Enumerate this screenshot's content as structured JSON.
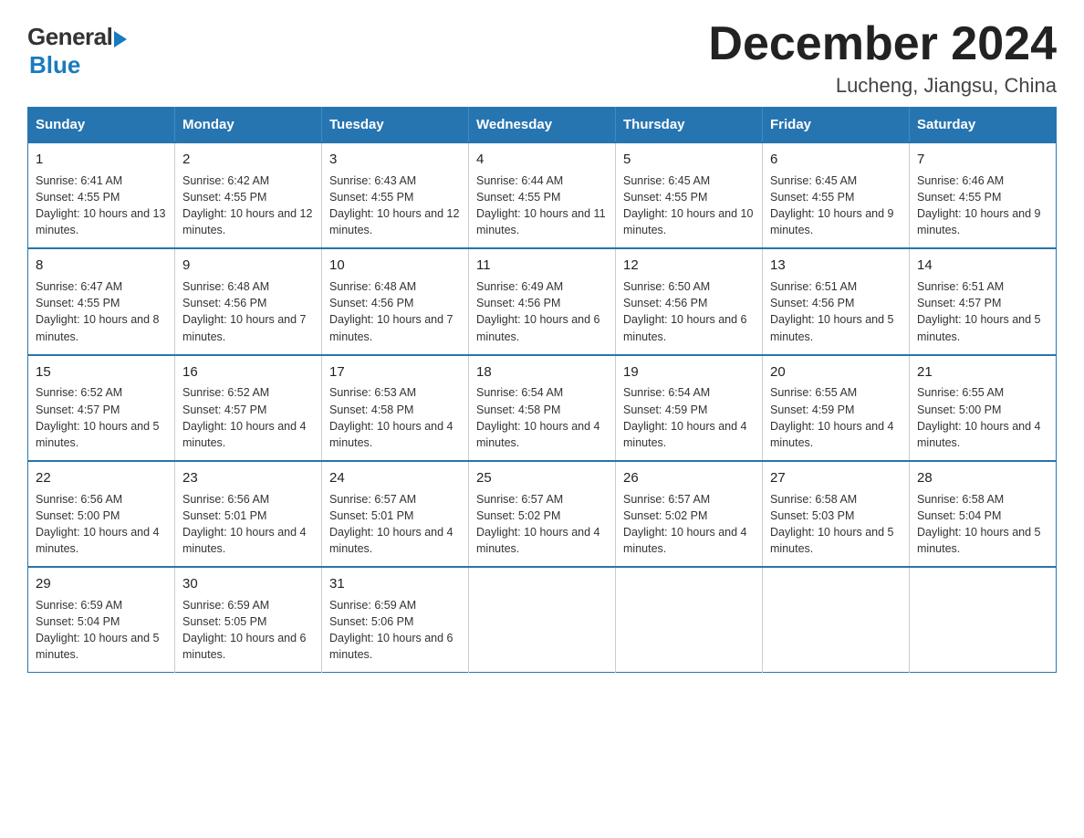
{
  "logo": {
    "general": "General",
    "blue": "Blue"
  },
  "title": "December 2024",
  "location": "Lucheng, Jiangsu, China",
  "days_of_week": [
    "Sunday",
    "Monday",
    "Tuesday",
    "Wednesday",
    "Thursday",
    "Friday",
    "Saturday"
  ],
  "weeks": [
    [
      {
        "num": "1",
        "sunrise": "6:41 AM",
        "sunset": "4:55 PM",
        "daylight": "10 hours and 13 minutes."
      },
      {
        "num": "2",
        "sunrise": "6:42 AM",
        "sunset": "4:55 PM",
        "daylight": "10 hours and 12 minutes."
      },
      {
        "num": "3",
        "sunrise": "6:43 AM",
        "sunset": "4:55 PM",
        "daylight": "10 hours and 12 minutes."
      },
      {
        "num": "4",
        "sunrise": "6:44 AM",
        "sunset": "4:55 PM",
        "daylight": "10 hours and 11 minutes."
      },
      {
        "num": "5",
        "sunrise": "6:45 AM",
        "sunset": "4:55 PM",
        "daylight": "10 hours and 10 minutes."
      },
      {
        "num": "6",
        "sunrise": "6:45 AM",
        "sunset": "4:55 PM",
        "daylight": "10 hours and 9 minutes."
      },
      {
        "num": "7",
        "sunrise": "6:46 AM",
        "sunset": "4:55 PM",
        "daylight": "10 hours and 9 minutes."
      }
    ],
    [
      {
        "num": "8",
        "sunrise": "6:47 AM",
        "sunset": "4:55 PM",
        "daylight": "10 hours and 8 minutes."
      },
      {
        "num": "9",
        "sunrise": "6:48 AM",
        "sunset": "4:56 PM",
        "daylight": "10 hours and 7 minutes."
      },
      {
        "num": "10",
        "sunrise": "6:48 AM",
        "sunset": "4:56 PM",
        "daylight": "10 hours and 7 minutes."
      },
      {
        "num": "11",
        "sunrise": "6:49 AM",
        "sunset": "4:56 PM",
        "daylight": "10 hours and 6 minutes."
      },
      {
        "num": "12",
        "sunrise": "6:50 AM",
        "sunset": "4:56 PM",
        "daylight": "10 hours and 6 minutes."
      },
      {
        "num": "13",
        "sunrise": "6:51 AM",
        "sunset": "4:56 PM",
        "daylight": "10 hours and 5 minutes."
      },
      {
        "num": "14",
        "sunrise": "6:51 AM",
        "sunset": "4:57 PM",
        "daylight": "10 hours and 5 minutes."
      }
    ],
    [
      {
        "num": "15",
        "sunrise": "6:52 AM",
        "sunset": "4:57 PM",
        "daylight": "10 hours and 5 minutes."
      },
      {
        "num": "16",
        "sunrise": "6:52 AM",
        "sunset": "4:57 PM",
        "daylight": "10 hours and 4 minutes."
      },
      {
        "num": "17",
        "sunrise": "6:53 AM",
        "sunset": "4:58 PM",
        "daylight": "10 hours and 4 minutes."
      },
      {
        "num": "18",
        "sunrise": "6:54 AM",
        "sunset": "4:58 PM",
        "daylight": "10 hours and 4 minutes."
      },
      {
        "num": "19",
        "sunrise": "6:54 AM",
        "sunset": "4:59 PM",
        "daylight": "10 hours and 4 minutes."
      },
      {
        "num": "20",
        "sunrise": "6:55 AM",
        "sunset": "4:59 PM",
        "daylight": "10 hours and 4 minutes."
      },
      {
        "num": "21",
        "sunrise": "6:55 AM",
        "sunset": "5:00 PM",
        "daylight": "10 hours and 4 minutes."
      }
    ],
    [
      {
        "num": "22",
        "sunrise": "6:56 AM",
        "sunset": "5:00 PM",
        "daylight": "10 hours and 4 minutes."
      },
      {
        "num": "23",
        "sunrise": "6:56 AM",
        "sunset": "5:01 PM",
        "daylight": "10 hours and 4 minutes."
      },
      {
        "num": "24",
        "sunrise": "6:57 AM",
        "sunset": "5:01 PM",
        "daylight": "10 hours and 4 minutes."
      },
      {
        "num": "25",
        "sunrise": "6:57 AM",
        "sunset": "5:02 PM",
        "daylight": "10 hours and 4 minutes."
      },
      {
        "num": "26",
        "sunrise": "6:57 AM",
        "sunset": "5:02 PM",
        "daylight": "10 hours and 4 minutes."
      },
      {
        "num": "27",
        "sunrise": "6:58 AM",
        "sunset": "5:03 PM",
        "daylight": "10 hours and 5 minutes."
      },
      {
        "num": "28",
        "sunrise": "6:58 AM",
        "sunset": "5:04 PM",
        "daylight": "10 hours and 5 minutes."
      }
    ],
    [
      {
        "num": "29",
        "sunrise": "6:59 AM",
        "sunset": "5:04 PM",
        "daylight": "10 hours and 5 minutes."
      },
      {
        "num": "30",
        "sunrise": "6:59 AM",
        "sunset": "5:05 PM",
        "daylight": "10 hours and 6 minutes."
      },
      {
        "num": "31",
        "sunrise": "6:59 AM",
        "sunset": "5:06 PM",
        "daylight": "10 hours and 6 minutes."
      },
      null,
      null,
      null,
      null
    ]
  ],
  "labels": {
    "sunrise": "Sunrise:",
    "sunset": "Sunset:",
    "daylight": "Daylight:"
  }
}
